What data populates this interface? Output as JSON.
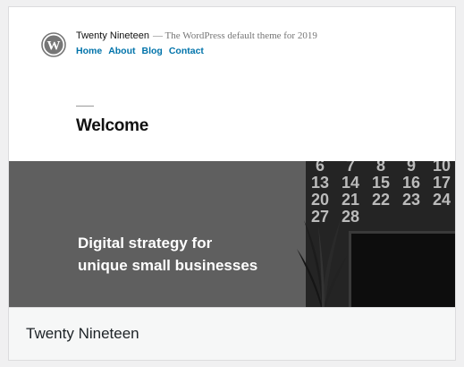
{
  "preview": {
    "site_title": "Twenty Nineteen",
    "site_description": "— The WordPress default theme for 2019",
    "nav": [
      "Home",
      "About",
      "Blog",
      "Contact"
    ],
    "page_title": "Welcome",
    "hero_line1": "Digital strategy for",
    "hero_line2": "unique small businesses",
    "calendar_rows": [
      [
        "6",
        "7",
        "8",
        "9",
        "10"
      ],
      [
        "13",
        "14",
        "15",
        "16",
        "17"
      ],
      [
        "20",
        "21",
        "22",
        "23",
        "24"
      ],
      [
        "27",
        "28",
        "",
        "",
        ""
      ]
    ]
  },
  "theme": {
    "name": "Twenty Nineteen"
  },
  "colors": {
    "link": "#0073aa",
    "hero_overlay": "#5f5f5f"
  },
  "icons": {
    "logo": "wordpress-logo-icon"
  }
}
